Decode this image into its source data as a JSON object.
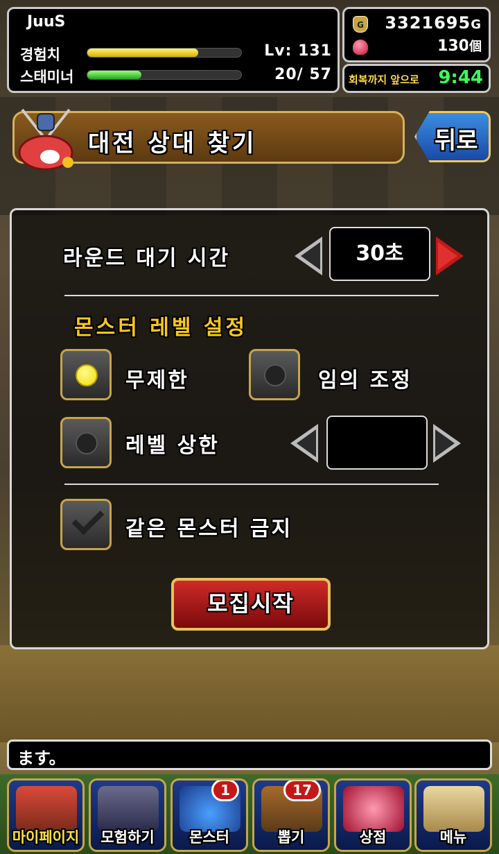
{
  "player": {
    "name": "JuuS",
    "exp_label": "경험치",
    "exp_fraction": 0.72,
    "stamina_label": "스태미너",
    "stamina_fraction": 0.35,
    "level_text": "Lv: 131",
    "stamina_text": "20/ 57"
  },
  "currency": {
    "gold_value": "3321695",
    "gold_unit": "G",
    "gem_value": "130",
    "gem_unit": "個"
  },
  "recovery": {
    "label": "회복까지 앞으로",
    "timer": "9:44"
  },
  "header": {
    "title": "대전 상대 찾기",
    "back_label": "뒤로"
  },
  "settings": {
    "round_wait_label": "라운드 대기 시간",
    "round_wait_value": "30초",
    "level_section_title": "몬스터 레벨 설정",
    "option_unlimited": "무제한",
    "option_random": "임의 조정",
    "option_level_cap": "레벨 상한",
    "level_cap_value": "",
    "same_monster_label": "같은 몬스터 금지",
    "start_label": "모집시작"
  },
  "message": {
    "text": "ます。"
  },
  "nav": {
    "items": [
      {
        "label": "마이페이지",
        "badge": ""
      },
      {
        "label": "모험하기",
        "badge": ""
      },
      {
        "label": "몬스터",
        "badge": "1"
      },
      {
        "label": "뽑기",
        "badge": "17"
      },
      {
        "label": "상점",
        "badge": ""
      },
      {
        "label": "메뉴",
        "badge": ""
      }
    ]
  },
  "colors": {
    "accent_gold": "#c9a548",
    "section_title": "#ffc81e",
    "timer_green": "#3bff5a",
    "start_red": "#c41818"
  }
}
